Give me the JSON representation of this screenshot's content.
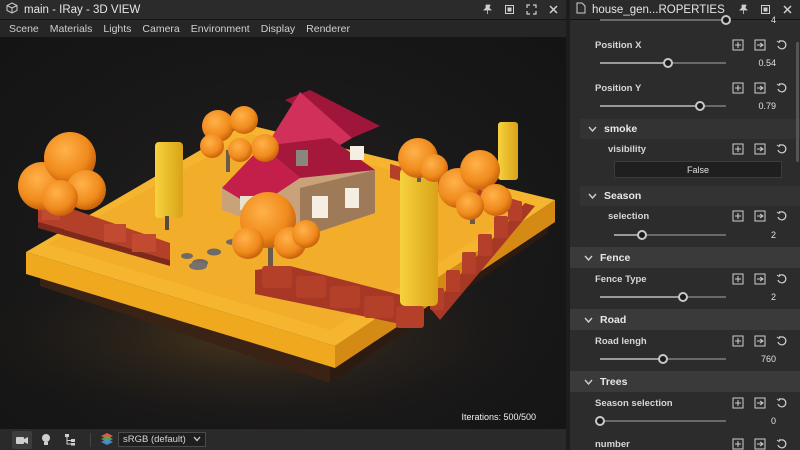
{
  "viewport": {
    "title": "main - IRay - 3D VIEW",
    "icons": [
      "cube-icon",
      "pin-icon",
      "restore-icon",
      "maximize-icon",
      "close-icon"
    ],
    "menu": [
      "Scene",
      "Materials",
      "Lights",
      "Camera",
      "Environment",
      "Display",
      "Renderer"
    ],
    "iterations": "Iterations: 500/500",
    "statusbar": {
      "tools": [
        "camera-icon",
        "light-bulb-icon",
        "hierarchy-icon"
      ],
      "color_space_icon": "layers-icon",
      "color_space": "sRGB (default)"
    }
  },
  "properties": {
    "title": "house_gen...ROPERTIES",
    "top_value": "4",
    "rows": {
      "position_x": {
        "label": "Position X",
        "value": "0.54",
        "fraction": 0.54
      },
      "position_y": {
        "label": "Position Y",
        "value": "0.79",
        "fraction": 0.79
      },
      "smoke": {
        "header": "smoke",
        "visibility_label": "visibility",
        "visibility_value": "False"
      },
      "season": {
        "header": "Season",
        "selection_label": "selection",
        "selection_value": "2",
        "fraction": 0.25
      },
      "fence": {
        "header": "Fence",
        "type_label": "Fence Type",
        "type_value": "2",
        "fraction": 0.66
      },
      "road": {
        "header": "Road",
        "length_label": "Road lengh",
        "length_value": "760",
        "fraction": 0.5
      },
      "trees": {
        "header": "Trees",
        "season_label": "Season selection",
        "season_value": "0",
        "fraction": 0.0,
        "number_label": "number"
      }
    },
    "action_icons": [
      "add-keyframe-icon",
      "set-key-icon",
      "reset-icon"
    ]
  },
  "colors": {
    "ground": "#f5b52e",
    "foliage": "#f08a1c",
    "roof": "#c41f4a",
    "brick": "#b5402a",
    "platform": "#f0a91e"
  }
}
